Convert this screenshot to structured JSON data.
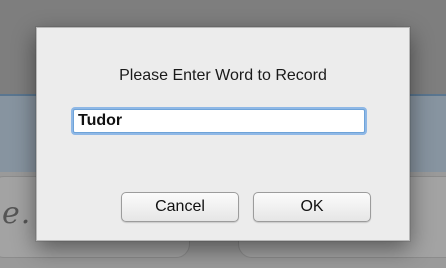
{
  "background": {
    "partial_text": "e."
  },
  "dialog": {
    "prompt": "Please Enter Word to Record",
    "input_value": "Tudor",
    "cancel_label": "Cancel",
    "ok_label": "OK"
  }
}
